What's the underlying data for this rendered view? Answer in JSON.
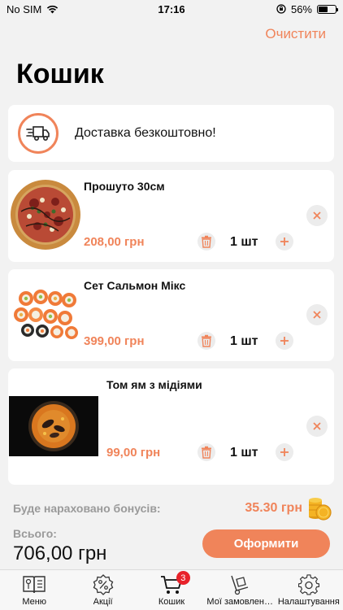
{
  "status_bar": {
    "carrier": "No SIM",
    "time": "17:16",
    "battery_percent": "56%",
    "battery_level": 0.56,
    "icons": [
      "wifi-icon",
      "orientation-lock-icon",
      "battery-icon"
    ]
  },
  "header": {
    "clear_label": "Очистити",
    "title": "Кошик"
  },
  "delivery": {
    "icon": "delivery-truck-icon",
    "text": "Доставка безкоштовно!"
  },
  "cart": {
    "items": [
      {
        "name": "Прошуто  30см",
        "price": "208,00 грн",
        "qty": "1 шт",
        "image": "pizza-image"
      },
      {
        "name": "Сет Сальмон Мікс",
        "price": "399,00 грн",
        "qty": "1 шт",
        "image": "sushi-set-image"
      },
      {
        "name": "Том ям з мідіями",
        "price": "99,00 грн",
        "qty": "1 шт",
        "image": "tom-yam-soup-image"
      }
    ]
  },
  "summary": {
    "bonus_label": "Буде нараховано бонусів:",
    "bonus_value": "35.30 грн",
    "total_label": "Всього:",
    "total_value": "706,00 грн",
    "checkout_label": "Оформити"
  },
  "tabbar": {
    "tabs": [
      {
        "label": "Меню",
        "icon": "menu-book-icon"
      },
      {
        "label": "Акції",
        "icon": "discount-badge-icon"
      },
      {
        "label": "Кошик",
        "icon": "cart-icon",
        "badge": "3"
      },
      {
        "label": "Мої замовлення",
        "icon": "hand-truck-icon"
      },
      {
        "label": "Налаштування",
        "icon": "gear-icon"
      }
    ]
  },
  "colors": {
    "accent": "#f0845a",
    "badge": "#e8222a",
    "background": "#f2f2f2"
  }
}
